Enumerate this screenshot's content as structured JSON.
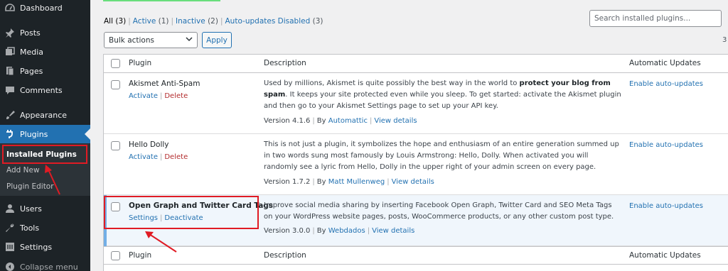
{
  "sidebar": {
    "items": [
      {
        "label": "Dashboard",
        "icon": "dashboard-icon"
      },
      {
        "label": "Posts",
        "icon": "pin-icon"
      },
      {
        "label": "Media",
        "icon": "media-icon"
      },
      {
        "label": "Pages",
        "icon": "pages-icon"
      },
      {
        "label": "Comments",
        "icon": "comment-icon"
      },
      {
        "label": "Appearance",
        "icon": "brush-icon"
      },
      {
        "label": "Plugins",
        "icon": "plug-icon"
      },
      {
        "label": "Users",
        "icon": "user-icon"
      },
      {
        "label": "Tools",
        "icon": "wrench-icon"
      },
      {
        "label": "Settings",
        "icon": "settings-icon"
      },
      {
        "label": "Collapse menu",
        "icon": "collapse-icon"
      }
    ],
    "submenu": [
      "Installed Plugins",
      "Add New",
      "Plugin Editor"
    ]
  },
  "filters": {
    "all": "All",
    "all_count": "(3)",
    "active": "Active",
    "active_count": "(1)",
    "inactive": "Inactive",
    "inactive_count": "(2)",
    "auto_disabled": "Auto-updates Disabled",
    "auto_disabled_count": "(3)",
    "sep": "|"
  },
  "search": {
    "placeholder": "Search installed plugins..."
  },
  "items_count_fragment": "3",
  "bulk": {
    "selected": "Bulk actions",
    "apply": "Apply"
  },
  "table": {
    "headers": {
      "plugin": "Plugin",
      "description": "Description",
      "auto": "Automatic Updates"
    },
    "rows": [
      {
        "name": "Akismet Anti-Spam",
        "actions": [
          "Activate",
          "Delete"
        ],
        "desc_pre": "Used by millions, Akismet is quite possibly the best way in the world to ",
        "desc_bold": "protect your blog from spam",
        "desc_post": ". It keeps your site protected even while you sleep. To get started: activate the Akismet plugin and then go to your Akismet Settings page to set up your API key.",
        "version": "Version 4.1.6",
        "by": "By",
        "author": "Automattic",
        "details": "View details",
        "auto": "Enable auto-updates"
      },
      {
        "name": "Hello Dolly",
        "actions": [
          "Activate",
          "Delete"
        ],
        "desc": "This is not just a plugin, it symbolizes the hope and enthusiasm of an entire generation summed up in two words sung most famously by Louis Armstrong: Hello, Dolly. When activated you will randomly see a lyric from Hello, Dolly in the upper right of your admin screen on every page.",
        "version": "Version 1.7.2",
        "by": "By",
        "author": "Matt Mullenweg",
        "details": "View details",
        "auto": "Enable auto-updates"
      },
      {
        "name": "Open Graph and Twitter Card Tags",
        "actions": [
          "Settings",
          "Deactivate"
        ],
        "desc": "Improve social media sharing by inserting Facebook Open Graph, Twitter Card and SEO Meta Tags on your WordPress website pages, posts, WooCommerce products, or any other custom post type.",
        "version": "Version 3.0.0",
        "by": "By",
        "author": "Webdados",
        "details": "View details",
        "auto": "Enable auto-updates"
      }
    ]
  },
  "colors": {
    "accent": "#2271b1",
    "annotation": "#e01b24",
    "sidebar": "#1d2327"
  }
}
